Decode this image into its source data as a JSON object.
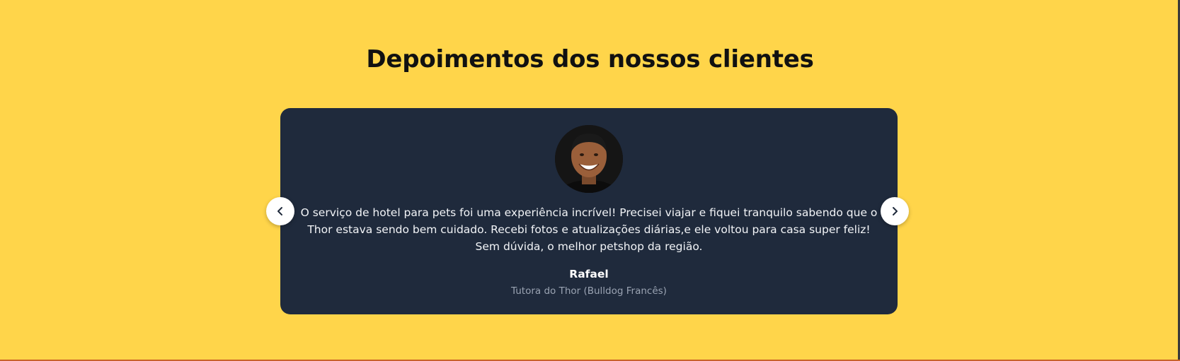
{
  "section": {
    "title": "Depoimentos dos nossos clientes",
    "background_color": "#ffd54a"
  },
  "testimonial": {
    "quote": "O serviço de hotel para pets foi uma experiência incrível! Precisei viajar e fiquei tranquilo sabendo que o Thor estava sendo bem cuidado. Recebi fotos e atualizações diárias,e ele voltou para casa super feliz! Sem dúvida, o melhor petshop da região.",
    "name": "Rafael",
    "role": "Tutora do Thor (Bulldog Francês)",
    "card_color": "#1f2a3c"
  },
  "carousel": {
    "prev_icon": "chevron-left-icon",
    "next_icon": "chevron-right-icon"
  }
}
